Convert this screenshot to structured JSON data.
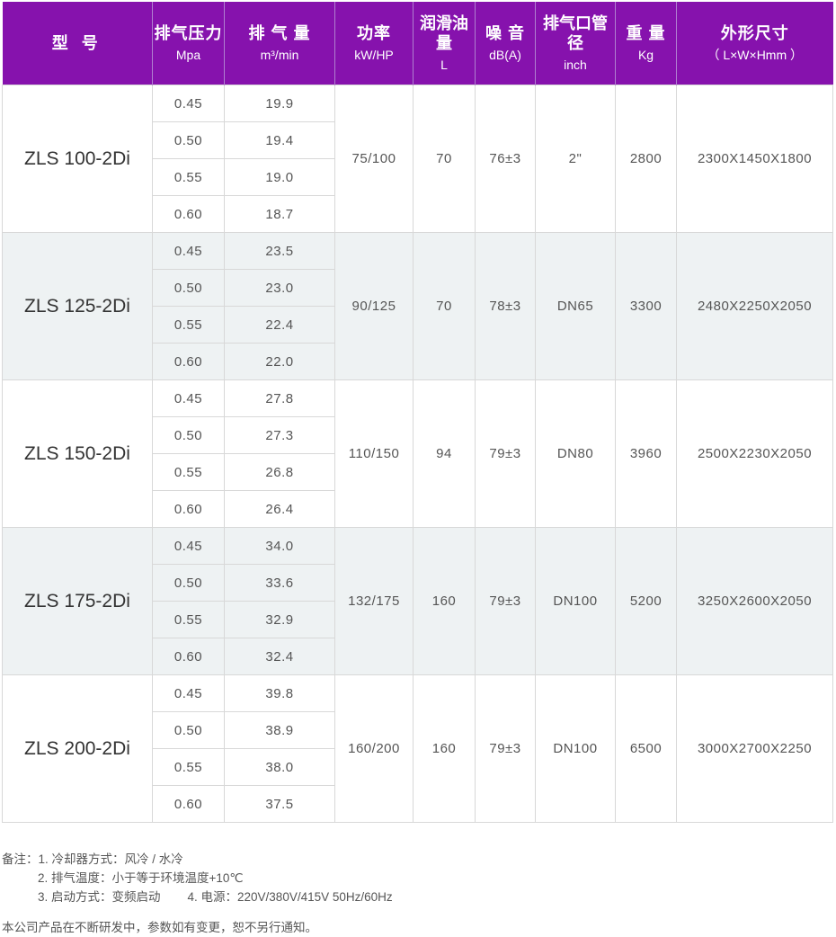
{
  "header": {
    "model": {
      "main": "型 号",
      "unit": ""
    },
    "pressure": {
      "main": "排气压力",
      "unit": "Mpa"
    },
    "flow": {
      "main": "排 气 量",
      "unit": "m³/min"
    },
    "power": {
      "main": "功率",
      "unit": "kW/HP"
    },
    "oil": {
      "main": "润滑油量",
      "unit": "L"
    },
    "noise": {
      "main": "噪 音",
      "unit": "dB(A)"
    },
    "outlet": {
      "main": "排气口管径",
      "unit": "inch"
    },
    "weight": {
      "main": "重 量",
      "unit": "Kg"
    },
    "dimensions": {
      "main": "外形尺寸",
      "unit": "（ L×W×Hmm ）"
    }
  },
  "models": [
    {
      "name": "ZLS 100-2Di",
      "rows": [
        {
          "pressure": "0.45",
          "flow": "19.9"
        },
        {
          "pressure": "0.50",
          "flow": "19.4"
        },
        {
          "pressure": "0.55",
          "flow": "19.0"
        },
        {
          "pressure": "0.60",
          "flow": "18.7"
        }
      ],
      "power": "75/100",
      "oil": "70",
      "noise": "76±3",
      "outlet": "2\"",
      "weight": "2800",
      "dimensions": "2300X1450X1800"
    },
    {
      "name": "ZLS 125-2Di",
      "rows": [
        {
          "pressure": "0.45",
          "flow": "23.5"
        },
        {
          "pressure": "0.50",
          "flow": "23.0"
        },
        {
          "pressure": "0.55",
          "flow": "22.4"
        },
        {
          "pressure": "0.60",
          "flow": "22.0"
        }
      ],
      "power": "90/125",
      "oil": "70",
      "noise": "78±3",
      "outlet": "DN65",
      "weight": "3300",
      "dimensions": "2480X2250X2050"
    },
    {
      "name": "ZLS 150-2Di",
      "rows": [
        {
          "pressure": "0.45",
          "flow": "27.8"
        },
        {
          "pressure": "0.50",
          "flow": "27.3"
        },
        {
          "pressure": "0.55",
          "flow": "26.8"
        },
        {
          "pressure": "0.60",
          "flow": "26.4"
        }
      ],
      "power": "110/150",
      "oil": "94",
      "noise": "79±3",
      "outlet": "DN80",
      "weight": "3960",
      "dimensions": "2500X2230X2050"
    },
    {
      "name": "ZLS 175-2Di",
      "rows": [
        {
          "pressure": "0.45",
          "flow": "34.0"
        },
        {
          "pressure": "0.50",
          "flow": "33.6"
        },
        {
          "pressure": "0.55",
          "flow": "32.9"
        },
        {
          "pressure": "0.60",
          "flow": "32.4"
        }
      ],
      "power": "132/175",
      "oil": "160",
      "noise": "79±3",
      "outlet": "DN100",
      "weight": "5200",
      "dimensions": "3250X2600X2050"
    },
    {
      "name": "ZLS 200-2Di",
      "rows": [
        {
          "pressure": "0.45",
          "flow": "39.8"
        },
        {
          "pressure": "0.50",
          "flow": "38.9"
        },
        {
          "pressure": "0.55",
          "flow": "38.0"
        },
        {
          "pressure": "0.60",
          "flow": "37.5"
        }
      ],
      "power": "160/200",
      "oil": "160",
      "noise": "79±3",
      "outlet": "DN100",
      "weight": "6500",
      "dimensions": "3000X2700X2250"
    }
  ],
  "notes": {
    "line1": "备注：1. 冷却器方式：风冷 / 水冷",
    "line2": "2. 排气温度：小于等于环境温度+10℃",
    "line3a": "3. 启动方式：变频启动",
    "line3b": "4. 电源：220V/380V/415V   50Hz/60Hz"
  },
  "footer": "本公司产品在不断研发中，参数如有变更，恕不另行通知。",
  "colors": {
    "header_bg": "#8612ad",
    "alt_row_bg": "#eef2f3",
    "border": "#d8d8d8"
  }
}
